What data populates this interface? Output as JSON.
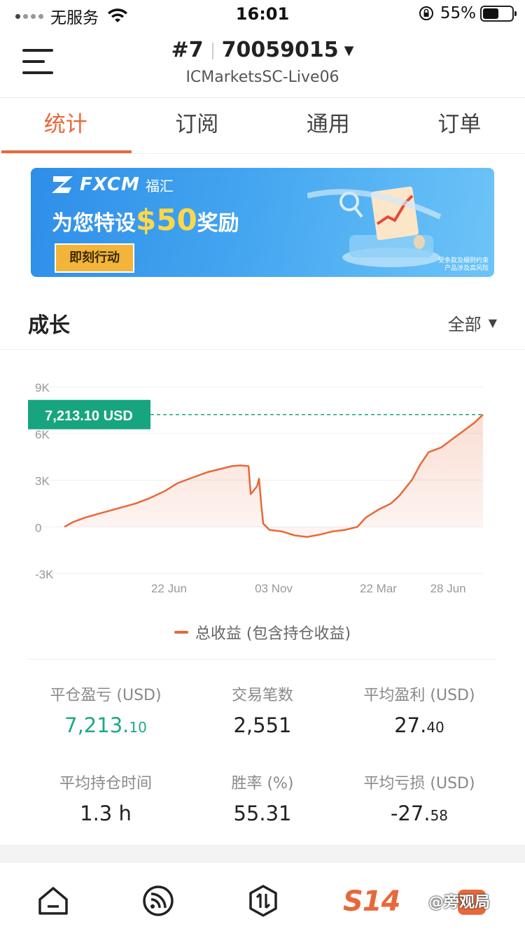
{
  "status_bar": {
    "carrier": "无服务",
    "time": "16:01",
    "battery": "55%"
  },
  "header": {
    "account_index": "#7",
    "account_number": "70059015",
    "server": "ICMarketsSC-Live06"
  },
  "tabs": [
    {
      "label": "统计",
      "active": true
    },
    {
      "label": "订阅",
      "active": false
    },
    {
      "label": "通用",
      "active": false
    },
    {
      "label": "订单",
      "active": false
    }
  ],
  "banner": {
    "brand": "FXCM",
    "brand_cn": "福汇",
    "title_prefix": "为您特设",
    "amount": "$50",
    "title_suffix": "奖励",
    "cta": "即刻行动",
    "fine_print_1": "受条款及细则约束",
    "fine_print_2": "产品涉及高风险"
  },
  "growth": {
    "title": "成长",
    "range": "全部"
  },
  "chart_data": {
    "type": "area",
    "current_value_label": "7,213.10 USD",
    "current_value": 7213.1,
    "y_ticks": [
      "9K",
      "6K",
      "3K",
      "0",
      "-3K"
    ],
    "ylim": [
      -3000,
      9000
    ],
    "x_ticks": [
      "22 Jun",
      "03 Nov",
      "22 Mar",
      "28 Jun"
    ],
    "grid": true,
    "series": [
      {
        "name": "总收益 (包含持仓收益)",
        "color": "#e8683a",
        "points": [
          [
            0,
            0
          ],
          [
            0.02,
            300
          ],
          [
            0.05,
            600
          ],
          [
            0.09,
            900
          ],
          [
            0.13,
            1200
          ],
          [
            0.17,
            1500
          ],
          [
            0.2,
            1800
          ],
          [
            0.24,
            2300
          ],
          [
            0.27,
            2800
          ],
          [
            0.31,
            3200
          ],
          [
            0.34,
            3500
          ],
          [
            0.37,
            3700
          ],
          [
            0.4,
            3900
          ],
          [
            0.42,
            3950
          ],
          [
            0.44,
            3900
          ],
          [
            0.445,
            2100
          ],
          [
            0.46,
            2600
          ],
          [
            0.465,
            3100
          ],
          [
            0.47,
            1500
          ],
          [
            0.475,
            200
          ],
          [
            0.49,
            -200
          ],
          [
            0.52,
            -300
          ],
          [
            0.55,
            -550
          ],
          [
            0.58,
            -650
          ],
          [
            0.61,
            -500
          ],
          [
            0.64,
            -300
          ],
          [
            0.67,
            -200
          ],
          [
            0.7,
            0
          ],
          [
            0.72,
            600
          ],
          [
            0.75,
            1100
          ],
          [
            0.78,
            1500
          ],
          [
            0.8,
            2000
          ],
          [
            0.83,
            3000
          ],
          [
            0.85,
            4000
          ],
          [
            0.87,
            4800
          ],
          [
            0.9,
            5100
          ],
          [
            0.93,
            5700
          ],
          [
            0.96,
            6300
          ],
          [
            0.98,
            6700
          ],
          [
            1.0,
            7213.1
          ]
        ]
      }
    ],
    "legend": "总收益 (包含持仓收益)"
  },
  "stats": {
    "closed_pl_label": "平仓盈亏 (USD)",
    "closed_pl_int": "7,213.",
    "closed_pl_dec": "10",
    "trades_label": "交易笔数",
    "trades_value": "2,551",
    "avg_profit_label": "平均盈利 (USD)",
    "avg_profit_int": "27.",
    "avg_profit_dec": "40",
    "avg_hold_label": "平均持仓时间",
    "avg_hold_value": "1.3 h",
    "win_rate_label": "胜率 (%)",
    "win_rate_value": "55.31",
    "avg_loss_label": "平均亏损 (USD)",
    "avg_loss_int": "-27.",
    "avg_loss_dec": "58"
  },
  "bottom_nav": {
    "s14_label": "S14",
    "watermark": "@旁观局"
  },
  "colors": {
    "accent": "#e8683a",
    "profit_green": "#1ea985",
    "badge_green": "#17a57f"
  }
}
